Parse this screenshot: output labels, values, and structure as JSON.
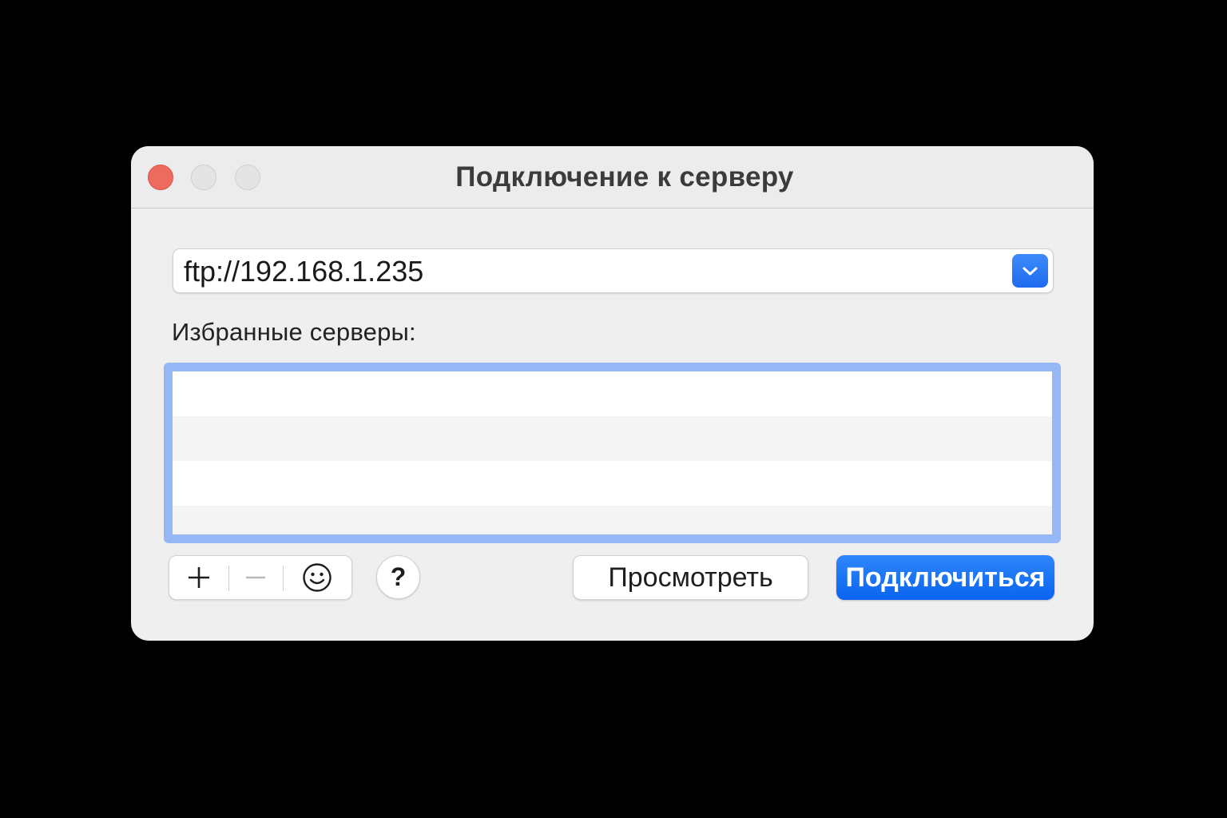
{
  "window": {
    "title": "Подключение к серверу"
  },
  "server_address": {
    "value": "ftp://192.168.1.235"
  },
  "favorites": {
    "label": "Избранные серверы:",
    "items": []
  },
  "toolbar": {
    "add_icon": "plus-icon",
    "remove_icon": "minus-icon",
    "action_icon": "smiley-icon",
    "help_label": "?"
  },
  "buttons": {
    "browse_label": "Просмотреть",
    "connect_label": "Подключиться"
  },
  "colors": {
    "accent": "#0a64ee",
    "focus_ring": "#95b7f5",
    "close_button": "#ec6a5e"
  }
}
